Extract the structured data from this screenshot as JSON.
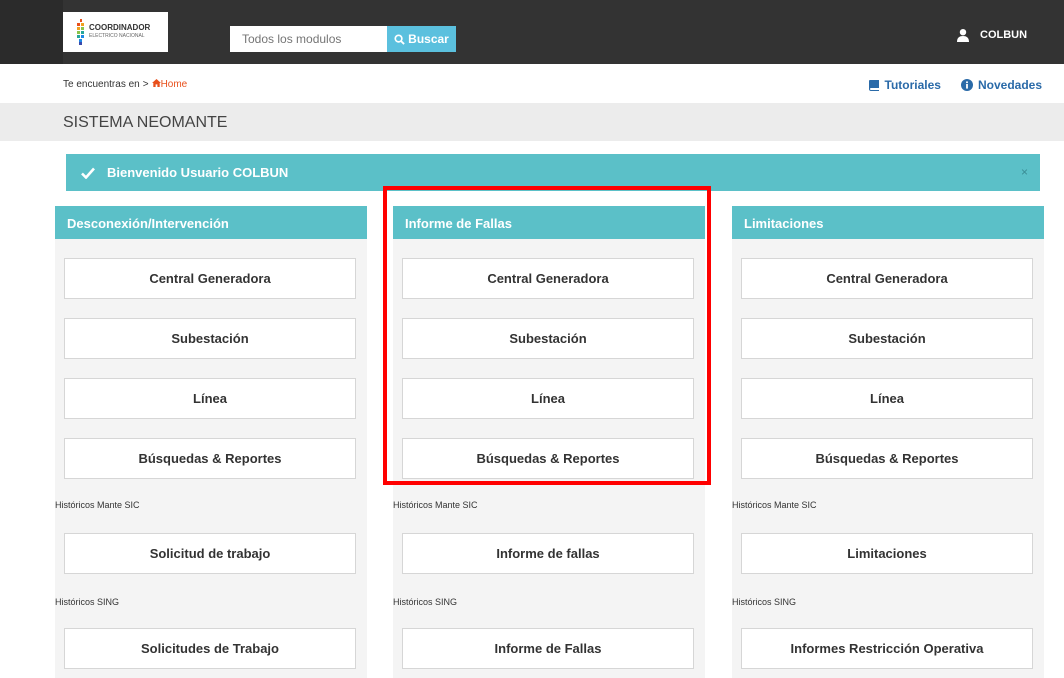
{
  "header": {
    "logo": {
      "line1": "COORDINADOR",
      "line2": "ELECTRICO NACIONAL"
    },
    "search": {
      "placeholder": "Todos los modulos",
      "button_label": "Buscar"
    },
    "user": {
      "name": "COLBUN"
    }
  },
  "breadcrumb": {
    "prefix": "Te encuentras en",
    "separator": ">",
    "home": "Home"
  },
  "links": {
    "tutorials": "Tutoriales",
    "news": "Novedades"
  },
  "page_title": "SISTEMA NEOMANTE",
  "welcome": {
    "message": "Bienvenido Usuario COLBUN",
    "close": "×"
  },
  "columns": [
    {
      "title": "Desconexión/Intervención",
      "buttons": [
        "Central Generadora",
        "Subestación",
        "Línea",
        "Búsquedas & Reportes"
      ],
      "sic_label": "Históricos Mante SIC",
      "sic_button": "Solicitud de trabajo",
      "sing_label": "Históricos SING",
      "sing_button": "Solicitudes de Trabajo"
    },
    {
      "title": "Informe de Fallas",
      "buttons": [
        "Central Generadora",
        "Subestación",
        "Línea",
        "Búsquedas & Reportes"
      ],
      "sic_label": "Históricos Mante SIC",
      "sic_button": "Informe de fallas",
      "sing_label": "Históricos SING",
      "sing_button": "Informe de Fallas"
    },
    {
      "title": "Limitaciones",
      "buttons": [
        "Central Generadora",
        "Subestación",
        "Línea",
        "Búsquedas & Reportes"
      ],
      "sic_label": "Históricos Mante SIC",
      "sic_button": "Limitaciones",
      "sing_label": "Históricos SING",
      "sing_button": "Informes Restricción Operativa"
    }
  ],
  "colors": {
    "accent": "#5bc0c8",
    "topbar": "#333333",
    "highlight": "#ff0000",
    "link": "#2a6aa8",
    "home": "#e8501c"
  }
}
